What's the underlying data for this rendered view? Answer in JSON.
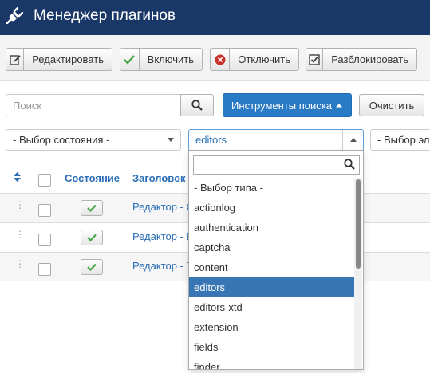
{
  "header": {
    "title": "Менеджер плагинов",
    "icon": "plug-icon"
  },
  "toolbar": {
    "edit_label": "Редактировать",
    "enable_label": "Включить",
    "disable_label": "Отключить",
    "unlock_label": "Разблокировать"
  },
  "search": {
    "placeholder": "Поиск",
    "tools_label": "Инструменты поиска",
    "clear_label": "Очистить"
  },
  "filters": {
    "state_select": "- Выбор состояния -",
    "type_select": "editors",
    "element_select": "- Выбор эл"
  },
  "table": {
    "headers": {
      "state": "Состояние",
      "title": "Заголовок"
    },
    "rows": [
      {
        "title": "Редактор - C"
      },
      {
        "title": "Редактор - E"
      },
      {
        "title": "Редактор - T"
      }
    ]
  },
  "type_dropdown": {
    "items": [
      "- Выбор типа -",
      "actionlog",
      "authentication",
      "captcha",
      "content",
      "editors",
      "editors-xtd",
      "extension",
      "fields",
      "finder"
    ],
    "selected": "editors"
  },
  "colors": {
    "header_bg": "#1a3867",
    "primary": "#2a7bc6",
    "link": "#2a6db5",
    "enabled_check": "#46a546",
    "disable_icon": "#c9302c"
  }
}
